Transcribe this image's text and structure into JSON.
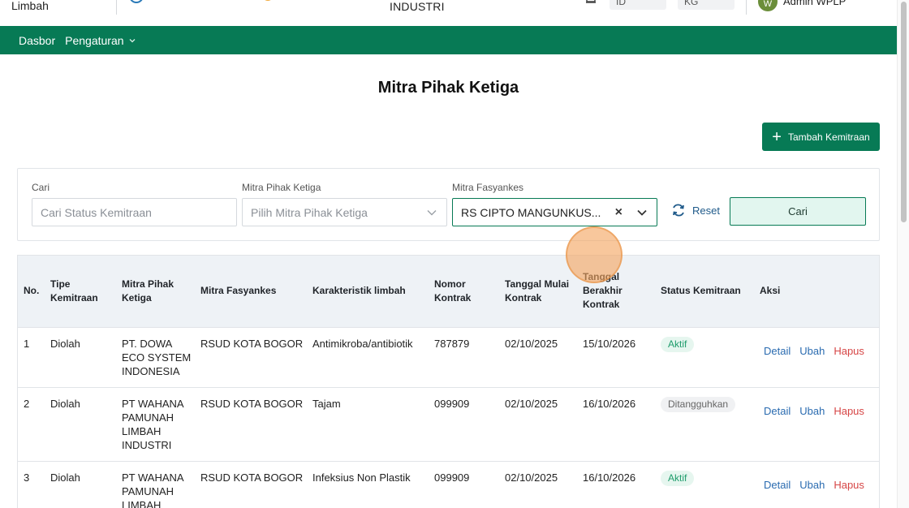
{
  "header": {
    "app_name": "Limbah",
    "industri_label": "INDUSTRI",
    "lang_1": "ID",
    "lang_2": "KG",
    "avatar_letter": "W",
    "user_name": "Admin WPLP"
  },
  "nav": {
    "items": [
      {
        "label": "Dasbor"
      },
      {
        "label": "Pengaturan"
      }
    ]
  },
  "page": {
    "title": "Mitra Pihak Ketiga",
    "add_button_label": "Tambah Kemitraan"
  },
  "filters": {
    "search": {
      "label": "Cari",
      "placeholder": "Cari Status Kemitraan"
    },
    "mitra_pihak_ketiga": {
      "label": "Mitra Pihak Ketiga",
      "placeholder": "Pilih Mitra Pihak Ketiga"
    },
    "mitra_fasyankes": {
      "label": "Mitra Fasyankes",
      "value": "RS CIPTO MANGUNKUS..."
    },
    "reset_label": "Reset",
    "search_button_label": "Cari"
  },
  "table": {
    "headers": {
      "no": "No.",
      "tipe_1": "Tipe",
      "tipe_2": "Kemitraan",
      "mpk_1": "Mitra Pihak",
      "mpk_2": "Ketiga",
      "mf": "Mitra Fasyankes",
      "kar": "Karakteristik limbah",
      "nom_1": "Nomor",
      "nom_2": "Kontrak",
      "tm_1": "Tanggal Mulai",
      "tm_2": "Kontrak",
      "tb_1": "Tanggal",
      "tb_2": "Berakhir",
      "tb_3": "Kontrak",
      "status": "Status Kemitraan",
      "aksi": "Aksi"
    },
    "rows": [
      {
        "no": "1",
        "tipe": "Diolah",
        "mpk_1": "PT. DOWA",
        "mpk_2": "ECO SYSTEM",
        "mpk_3": "INDONESIA",
        "mpk_4": "",
        "mf": "RSUD KOTA BOGOR",
        "kar": "Antimikroba/antibiotik",
        "nomor": "787879",
        "mulai": "02/10/2025",
        "berakhir": "15/10/2026",
        "status": "Aktif"
      },
      {
        "no": "2",
        "tipe": "Diolah",
        "mpk_1": "PT WAHANA",
        "mpk_2": "PAMUNAH",
        "mpk_3": "LIMBAH",
        "mpk_4": "INDUSTRI",
        "mf": "RSUD KOTA BOGOR",
        "kar": "Tajam",
        "nomor": "099909",
        "mulai": "02/10/2025",
        "berakhir": "16/10/2026",
        "status": "Ditangguhkan"
      },
      {
        "no": "3",
        "tipe": "Diolah",
        "mpk_1": "PT WAHANA",
        "mpk_2": "PAMUNAH",
        "mpk_3": "LIMBAH",
        "mpk_4": "",
        "mf": "RSUD KOTA BOGOR",
        "kar": "Infeksius Non Plastik",
        "nomor": "099909",
        "mulai": "02/10/2025",
        "berakhir": "16/10/2026",
        "status": "Aktif"
      }
    ],
    "actions": {
      "detail": "Detail",
      "ubah": "Ubah",
      "hapus": "Hapus"
    }
  },
  "colors": {
    "brand_green": "#077a55",
    "status_active": "#1e9c6b",
    "link_blue": "#2a6bb0",
    "danger_red": "#d64545"
  }
}
